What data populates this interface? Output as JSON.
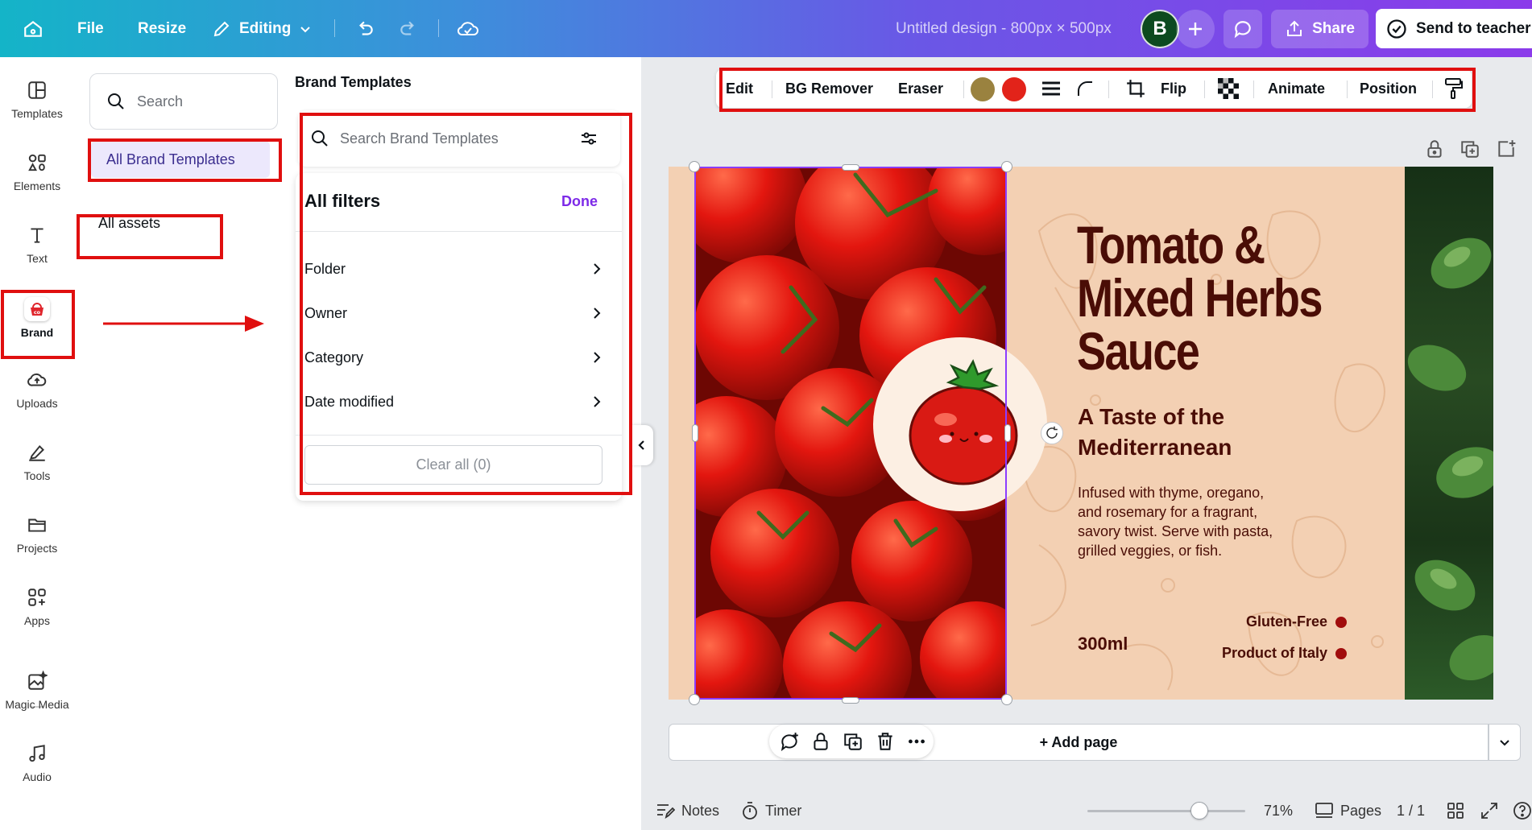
{
  "topbar": {
    "file": "File",
    "resize": "Resize",
    "editing": "Editing",
    "title": "Untitled design - 800px × 500px",
    "avatar_initial": "B",
    "share": "Share",
    "send": "Send to teacher"
  },
  "leftnav": {
    "items": [
      {
        "label": "Templates",
        "icon": "templates-icon"
      },
      {
        "label": "Elements",
        "icon": "elements-icon"
      },
      {
        "label": "Text",
        "icon": "text-icon"
      },
      {
        "label": "Brand",
        "icon": "brand-icon"
      },
      {
        "label": "Uploads",
        "icon": "upload-cloud-icon"
      },
      {
        "label": "Tools",
        "icon": "pen-icon"
      },
      {
        "label": "Projects",
        "icon": "folder-icon"
      },
      {
        "label": "Apps",
        "icon": "apps-icon"
      },
      {
        "label": "Magic Media",
        "icon": "magic-media-icon"
      },
      {
        "label": "Audio",
        "icon": "music-note-icon"
      }
    ],
    "brand_logo_text": "co"
  },
  "panel": {
    "search_placeholder": "Search",
    "all_brand_templates": "All Brand Templates",
    "all_assets": "All assets",
    "heading": "Brand Templates",
    "bt_search_placeholder": "Search Brand Templates",
    "filters": {
      "title": "All filters",
      "done": "Done",
      "rows": [
        "Folder",
        "Owner",
        "Category",
        "Date modified"
      ],
      "clear_all": "Clear all (0)"
    }
  },
  "toolbar": {
    "edit": "Edit",
    "bg_remover": "BG Remover",
    "eraser": "Eraser",
    "flip": "Flip",
    "animate": "Animate",
    "position": "Position",
    "swatch_1": "#9a823f",
    "swatch_2": "#e2231a"
  },
  "design": {
    "title_lines": [
      "Tomato &",
      "Mixed Herbs",
      "Sauce"
    ],
    "subtitle_lines": [
      "A Taste of the",
      "Mediterranean"
    ],
    "body_lines": [
      "Infused with thyme, oregano,",
      "and rosemary for a fragrant,",
      "savory twist. Serve with pasta,",
      "grilled veggies, or fish."
    ],
    "volume": "300ml",
    "badge_1": "Gluten-Free",
    "badge_2": "Product of Italy"
  },
  "bottom": {
    "add_page": "+ Add page"
  },
  "footer": {
    "notes": "Notes",
    "timer": "Timer",
    "zoom": "71%",
    "zoom_level": 0.71,
    "pages": "Pages",
    "page_count": "1 / 1"
  },
  "colors": {
    "accent": "#7d2ae8",
    "annotation": "#e00f0f",
    "design_background": "#f3d0b3",
    "design_text": "#4a0d06"
  }
}
